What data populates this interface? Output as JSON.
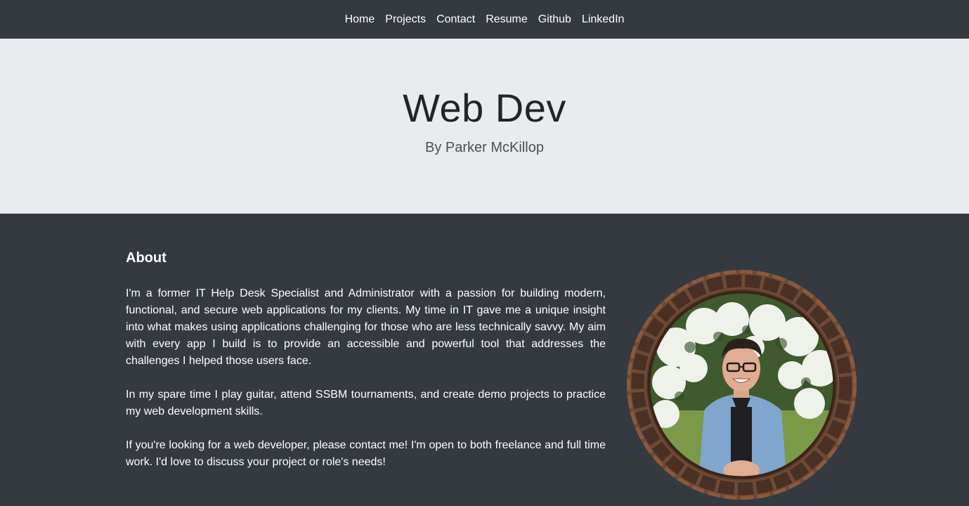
{
  "nav": {
    "items": [
      {
        "label": "Home"
      },
      {
        "label": "Projects"
      },
      {
        "label": "Contact"
      },
      {
        "label": "Resume"
      },
      {
        "label": "Github"
      },
      {
        "label": "LinkedIn"
      }
    ]
  },
  "hero": {
    "title": "Web Dev",
    "subtitle": "By Parker McKillop"
  },
  "about": {
    "heading": "About",
    "paragraphs": [
      "I'm a former IT Help Desk Specialist and Administrator with a passion for building modern, functional, and secure web applications for my clients. My time in IT gave me a unique insight into what makes using applications challenging for those who are less technically savvy. My aim with every app I build is to provide an accessible and powerful tool that addresses the challenges I helped those users face.",
      "In my spare time I play guitar, attend SSBM tournaments, and create demo projects to practice my web development skills.",
      "If you're looking for a web developer, please contact me! I'm open to both freelance and full time work. I'd love to discuss your project or role's needs!"
    ]
  },
  "colors": {
    "navbar_bg": "#343a40",
    "hero_bg": "#e9ecef",
    "page_bg": "#343a40",
    "text_light": "#ffffff"
  }
}
